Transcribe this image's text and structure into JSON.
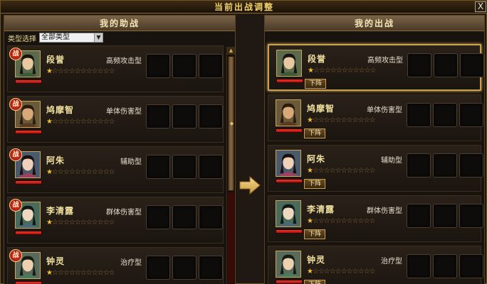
{
  "window": {
    "title": "当前出战调整",
    "close_label": "X"
  },
  "left_panel": {
    "title": "我的助战",
    "filter_label": "类型选择",
    "filter_value": "全部类型",
    "heroes": [
      {
        "badge": "战",
        "name": "段誉",
        "role": "高频攻击型",
        "stars_on": 1,
        "stars_total": 12,
        "hp": 1.0
      },
      {
        "badge": "战",
        "name": "鸠摩智",
        "role": "单体伤害型",
        "stars_on": 1,
        "stars_total": 12,
        "hp": 1.0
      },
      {
        "badge": "战",
        "name": "阿朱",
        "role": "辅助型",
        "stars_on": 1,
        "stars_total": 12,
        "hp": 1.0
      },
      {
        "badge": "战",
        "name": "李清露",
        "role": "群体伤害型",
        "stars_on": 1,
        "stars_total": 12,
        "hp": 1.0
      },
      {
        "badge": "战",
        "name": "钟灵",
        "role": "治疗型",
        "stars_on": 1,
        "stars_total": 12,
        "hp": 1.0
      }
    ]
  },
  "right_panel": {
    "title": "我的出战",
    "down_label": "下阵",
    "heroes": [
      {
        "name": "段誉",
        "role": "高频攻击型",
        "stars_on": 1,
        "stars_total": 12,
        "hp": 1.0
      },
      {
        "name": "鸠摩智",
        "role": "单体伤害型",
        "stars_on": 1,
        "stars_total": 12,
        "hp": 1.0
      },
      {
        "name": "阿朱",
        "role": "辅助型",
        "stars_on": 1,
        "stars_total": 12,
        "hp": 1.0
      },
      {
        "name": "李清露",
        "role": "群体伤害型",
        "stars_on": 1,
        "stars_total": 12,
        "hp": 1.0
      },
      {
        "name": "钟灵",
        "role": "治疗型",
        "stars_on": 1,
        "stars_total": 12,
        "hp": 1.0
      }
    ]
  },
  "icons": {
    "transfer": "arrow-right-icon",
    "scroll_up": "scroll-up-icon"
  },
  "colors": {
    "accent_gold": "#f0c030",
    "hp_red": "#e02a1a",
    "panel_header": "#6a5540"
  }
}
